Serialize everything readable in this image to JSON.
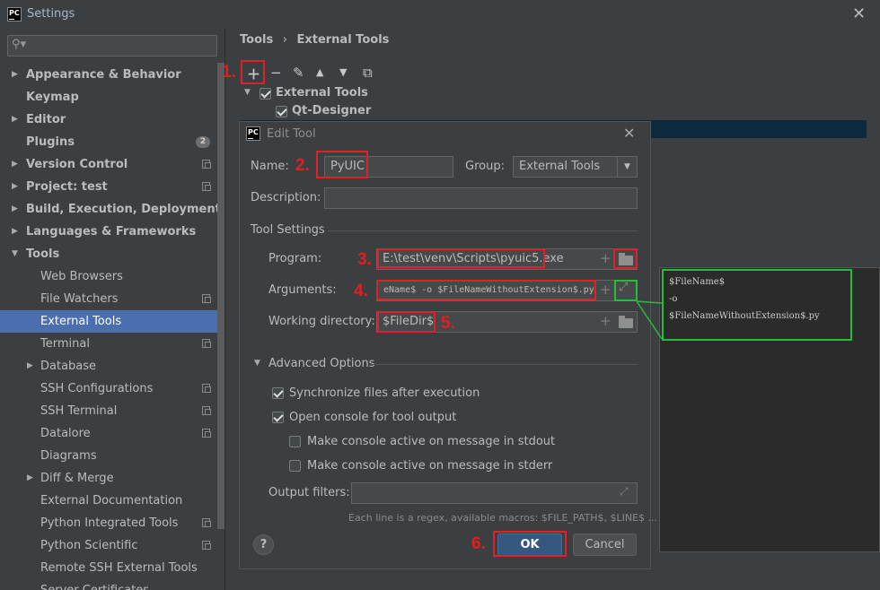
{
  "window": {
    "title": "Settings",
    "logo": "PC"
  },
  "search": {
    "placeholder": ""
  },
  "sidebar": {
    "items": [
      {
        "label": "Appearance & Behavior"
      },
      {
        "label": "Keymap"
      },
      {
        "label": "Editor"
      },
      {
        "label": "Plugins",
        "badge": "2"
      },
      {
        "label": "Version Control"
      },
      {
        "label": "Project: test"
      },
      {
        "label": "Build, Execution, Deployment"
      },
      {
        "label": "Languages & Frameworks"
      },
      {
        "label": "Tools"
      },
      {
        "label": "Web Browsers"
      },
      {
        "label": "File Watchers"
      },
      {
        "label": "External Tools"
      },
      {
        "label": "Terminal"
      },
      {
        "label": "Database"
      },
      {
        "label": "SSH Configurations"
      },
      {
        "label": "SSH Terminal"
      },
      {
        "label": "Datalore"
      },
      {
        "label": "Diagrams"
      },
      {
        "label": "Diff & Merge"
      },
      {
        "label": "External Documentation"
      },
      {
        "label": "Python Integrated Tools"
      },
      {
        "label": "Python Scientific"
      },
      {
        "label": "Remote SSH External Tools"
      },
      {
        "label": "Server Certificates"
      }
    ]
  },
  "breadcrumb": {
    "parent": "Tools",
    "separator": "›",
    "current": "External Tools"
  },
  "tree": {
    "group": "External Tools",
    "child": "Qt-Designer"
  },
  "annotations": {
    "n1": "1.",
    "n2": "2.",
    "n3": "3.",
    "n4": "4.",
    "n5": "5.",
    "n6": "6."
  },
  "dialog": {
    "title": "Edit Tool",
    "name_label": "Name:",
    "name_value": "PyUIC",
    "group_label": "Group:",
    "group_value": "External Tools",
    "description_label": "Description:",
    "description_value": "",
    "tool_settings_label": "Tool Settings",
    "program_label": "Program:",
    "program_value": "E:\\test\\venv\\Scripts\\pyuic5.exe",
    "arguments_label": "Arguments:",
    "arguments_value": "eName$ -o $FileNameWithoutExtension$.py",
    "workdir_label": "Working directory:",
    "workdir_value": "$FileDir$",
    "advanced_label": "Advanced Options",
    "sync_label": "Synchronize files after execution",
    "console_label": "Open console for tool output",
    "stdout_label": "Make console active on message in stdout",
    "stderr_label": "Make console active on message in stderr",
    "output_filters_label": "Output filters:",
    "hint": "Each line is a regex, available macros: $FILE_PATH$, $LINE$ ...",
    "help_label": "?",
    "ok_label": "OK",
    "cancel_label": "Cancel",
    "checkboxes": {
      "sync": true,
      "console": true,
      "stdout": false,
      "stderr": false
    }
  },
  "popup": {
    "lines": [
      "$FileName$",
      "-o",
      "$FileNameWithoutExtension$.py"
    ]
  },
  "colors": {
    "accent": "#4b6eaf",
    "annotation_red": "#e0202a",
    "annotation_green": "#2bbb3b",
    "ok_blue": "#365880"
  }
}
